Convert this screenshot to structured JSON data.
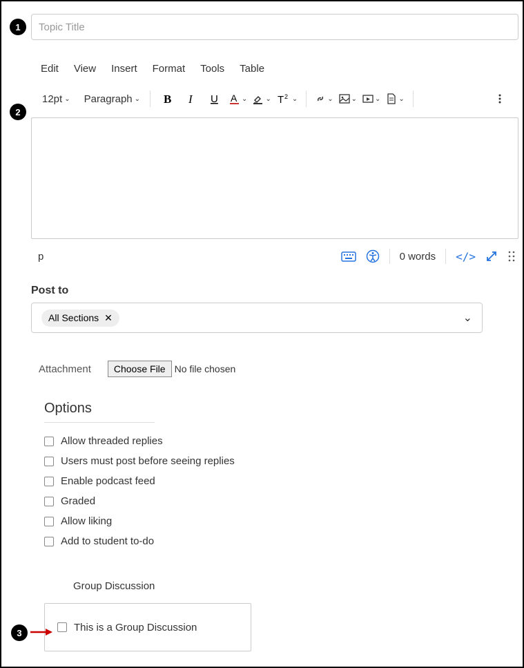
{
  "title_placeholder": "Topic Title",
  "menubar": {
    "edit": "Edit",
    "view": "View",
    "insert": "Insert",
    "format": "Format",
    "tools": "Tools",
    "table": "Table"
  },
  "toolbar": {
    "fontsize": "12pt",
    "block": "Paragraph"
  },
  "status": {
    "path": "p",
    "wordcount": "0 words",
    "code": "</>"
  },
  "post_to": {
    "label": "Post to",
    "chip": "All Sections"
  },
  "attachment": {
    "label": "Attachment",
    "button": "Choose File",
    "nofile": "No file chosen"
  },
  "options": {
    "heading": "Options",
    "items": [
      "Allow threaded replies",
      "Users must post before seeing replies",
      "Enable podcast feed",
      "Graded",
      "Allow liking",
      "Add to student to-do"
    ]
  },
  "group": {
    "heading": "Group Discussion",
    "checkbox": "This is a Group Discussion"
  },
  "badges": {
    "b1": "1",
    "b2": "2",
    "b3": "3"
  }
}
